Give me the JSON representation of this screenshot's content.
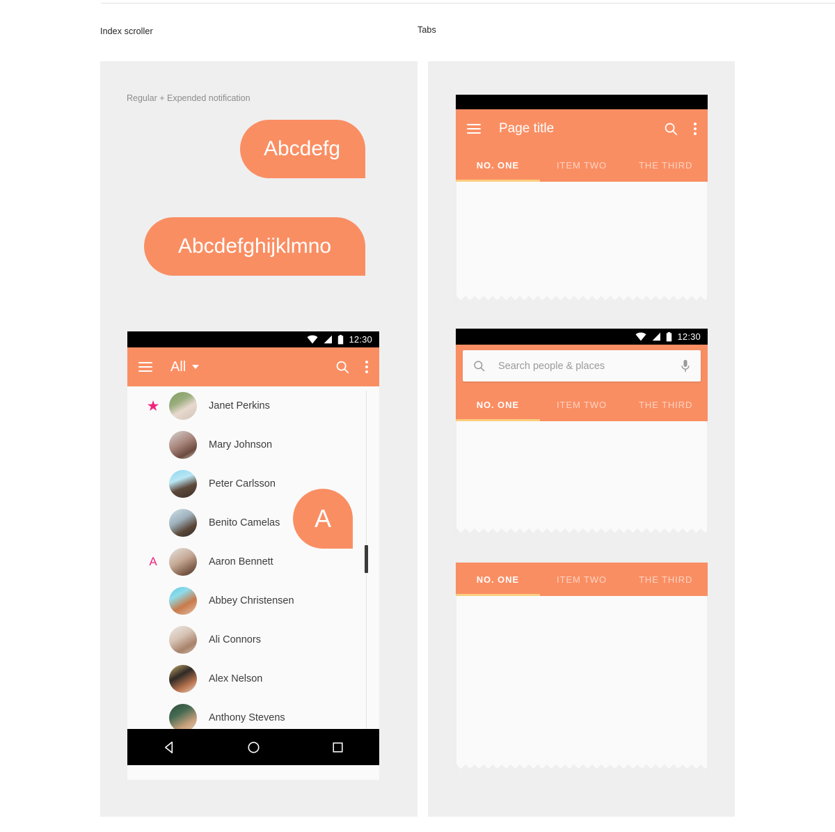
{
  "page": {
    "section_labels": {
      "index_scroller": "Index scroller",
      "tabs": "Tabs"
    },
    "colors": {
      "accent_orange": "#fa8e63",
      "panel_background": "#efefef",
      "sheet_background": "#fafafa",
      "tab_underline": "#fbce7e",
      "index_pink": "#f0247c",
      "statusbar": "#000000"
    }
  },
  "left_panel": {
    "caption": "Regular + Expended notification",
    "notifications": [
      {
        "label": "Abcdefg",
        "variant": "regular"
      },
      {
        "label": "Abcdefghijklmno",
        "variant": "expanded"
      }
    ],
    "device": {
      "statusbar": {
        "time": "12:30",
        "icons": [
          "wifi-icon",
          "signal-icon",
          "battery-icon"
        ]
      },
      "appbar": {
        "menu_icon": "hamburger-icon",
        "title": "All",
        "dropdown_icon": "caret-down-icon",
        "actions": [
          "search-icon",
          "overflow-menu-icon"
        ]
      },
      "index_bubble": {
        "letter": "A"
      },
      "contacts": [
        {
          "index": "★",
          "name": "Janet Perkins",
          "index_type": "star"
        },
        {
          "index": "",
          "name": "Mary Johnson",
          "index_type": "none"
        },
        {
          "index": "",
          "name": "Peter Carlsson",
          "index_type": "none"
        },
        {
          "index": "",
          "name": "Benito Camelas",
          "index_type": "none"
        },
        {
          "index": "A",
          "name": "Aaron Bennett",
          "index_type": "letter"
        },
        {
          "index": "",
          "name": "Abbey Christensen",
          "index_type": "none"
        },
        {
          "index": "",
          "name": "Ali Connors",
          "index_type": "none"
        },
        {
          "index": "",
          "name": "Alex Nelson",
          "index_type": "none"
        },
        {
          "index": "",
          "name": "Anthony Stevens",
          "index_type": "none"
        }
      ],
      "navbar": {
        "back": "back-triangle-icon",
        "home": "home-circle-icon",
        "recents": "recents-square-icon"
      }
    }
  },
  "right_panel": {
    "tabs": [
      {
        "label": "NO. ONE",
        "active": true
      },
      {
        "label": "ITEM TWO",
        "active": false
      },
      {
        "label": "THE THIRD",
        "active": false
      }
    ],
    "mockup_toolbar": {
      "menu_icon": "hamburger-icon",
      "title": "Page title",
      "actions": [
        "search-icon",
        "overflow-menu-icon"
      ]
    },
    "mockup_search": {
      "statusbar": {
        "time": "12:30"
      },
      "placeholder": "Search people & places",
      "leading_icon": "search-icon",
      "trailing_icon": "microphone-icon"
    }
  }
}
